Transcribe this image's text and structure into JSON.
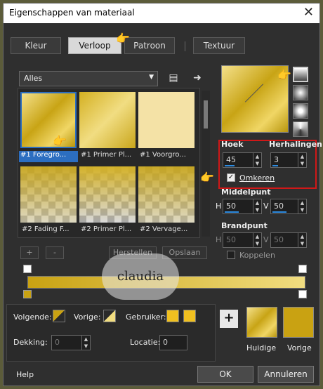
{
  "window": {
    "title": "Eigenschappen van materiaal",
    "close": "✕"
  },
  "tabs": [
    {
      "label": "Kleur"
    },
    {
      "label": "Verloop"
    },
    {
      "label": "Patroon"
    },
    {
      "label": "Textuur"
    }
  ],
  "library": {
    "category": "Alles",
    "items": [
      {
        "label": "#1 Foregro..."
      },
      {
        "label": "#1 Primer Pl..."
      },
      {
        "label": "#1 Voorgro..."
      },
      {
        "label": "#2 Fading F..."
      },
      {
        "label": "#2 Primer Pl..."
      },
      {
        "label": "#2 Vervage..."
      }
    ],
    "add": "+",
    "remove": "-",
    "restore": "Herstellen",
    "save": "Opslaan"
  },
  "settings": {
    "angle_label": "Hoek",
    "angle_value": "45",
    "repeats_label": "Herhalingen",
    "repeats_value": "3",
    "invert_label": "Omkeren",
    "center_label": "Middelpunt",
    "center_h_label": "H",
    "center_h": "50",
    "center_v_label": "V",
    "center_v": "50",
    "focal_label": "Brandpunt",
    "focal_h_label": "H",
    "focal_h": "50",
    "focal_v_label": "V",
    "focal_v": "50",
    "link_label": "Koppelen"
  },
  "stops": {
    "next_label": "Volgende:",
    "prev_label": "Vorige:",
    "user_label": "Gebruiker:",
    "opacity_label": "Dekking:",
    "opacity_value": "0",
    "location_label": "Locatie:",
    "location_value": "0",
    "add": "+"
  },
  "swatches": {
    "current_label": "Huidige",
    "previous_label": "Vorige"
  },
  "watermark": {
    "text": "claudia"
  },
  "footer": {
    "help": "Help",
    "ok": "OK",
    "cancel": "Annuleren"
  },
  "colors": {
    "gold_dark": "#c9a212",
    "gold_light": "#f1dd80",
    "selection": "#2c6ec0",
    "highlight": "#d01818"
  }
}
